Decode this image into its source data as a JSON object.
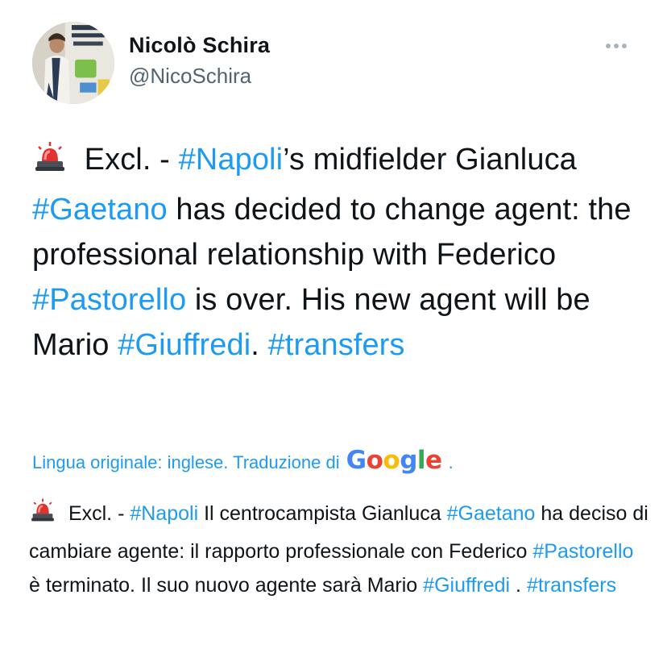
{
  "author": {
    "name": "Nicolò Schira",
    "handle": "@NicoSchira"
  },
  "tweet": {
    "segments": [
      {
        "type": "text",
        "text": " Excl. - "
      },
      {
        "type": "hashtag",
        "text": "#Napoli"
      },
      {
        "type": "text",
        "text": "’s midfielder Gianluca "
      },
      {
        "type": "hashtag",
        "text": "#Gaetano"
      },
      {
        "type": "text",
        "text": " has decided to change agent: the professional relationship with Federico "
      },
      {
        "type": "hashtag",
        "text": "#Pastorello"
      },
      {
        "type": "text",
        "text": " is over. His new agent will be Mario "
      },
      {
        "type": "hashtag",
        "text": "#Giuffredi"
      },
      {
        "type": "text",
        "text": ". "
      },
      {
        "type": "hashtag",
        "text": "#transfers"
      }
    ]
  },
  "translation": {
    "note": "Lingua originale: inglese. Traduzione di",
    "provider": "Google",
    "segments": [
      {
        "type": "text",
        "text": " Excl. - "
      },
      {
        "type": "hashtag",
        "text": "#Napoli"
      },
      {
        "type": "text",
        "text": " Il centrocampista Gianluca "
      },
      {
        "type": "hashtag",
        "text": "#Gaetano"
      },
      {
        "type": "text",
        "text": " ha deciso di cambiare agente: il rapporto professionale con Federico "
      },
      {
        "type": "hashtag",
        "text": "#Pastorello"
      },
      {
        "type": "text",
        "text": " è terminato. Il suo nuovo agente sarà Mario "
      },
      {
        "type": "hashtag",
        "text": "#Giuffredi"
      },
      {
        "type": "text",
        "text": " . "
      },
      {
        "type": "hashtag",
        "text": "#transfers"
      }
    ]
  },
  "icons": {
    "siren": "police-light-icon",
    "more": "more-options-icon"
  },
  "colors": {
    "hashtag": "#1d9bf0",
    "secondary_text": "#536471",
    "text": "#0f1419"
  }
}
